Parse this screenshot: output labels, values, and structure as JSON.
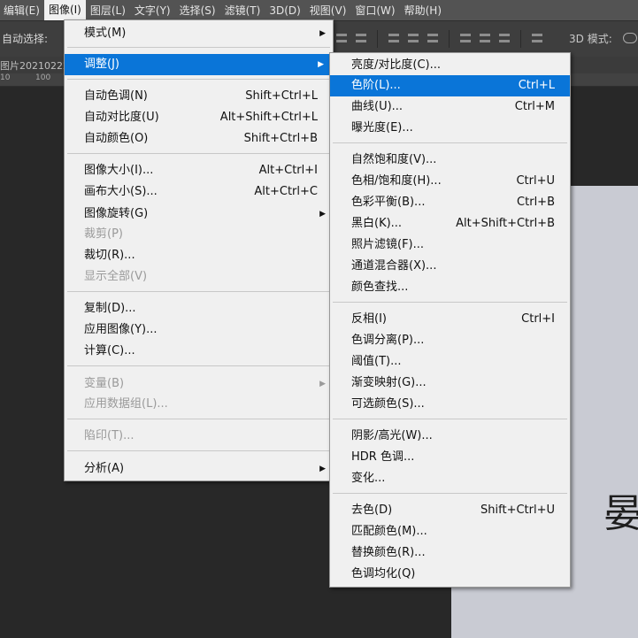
{
  "menubar": {
    "items": [
      {
        "label": "编辑(E)"
      },
      {
        "label": "图像(I)"
      },
      {
        "label": "图层(L)"
      },
      {
        "label": "文字(Y)"
      },
      {
        "label": "选择(S)"
      },
      {
        "label": "滤镜(T)"
      },
      {
        "label": "3D(D)"
      },
      {
        "label": "视图(V)"
      },
      {
        "label": "窗口(W)"
      },
      {
        "label": "帮助(H)"
      }
    ]
  },
  "options": {
    "auto_select": "自动选择:",
    "mode_3d": "3D 模式:"
  },
  "tab": {
    "name": "图片20210222"
  },
  "ruler": {
    "ticks": [
      "10",
      "100"
    ]
  },
  "image_menu": {
    "items": [
      {
        "label": "模式(M)",
        "shortcut": ""
      },
      {
        "label": "调整(J)",
        "shortcut": ""
      },
      {
        "label": "自动色调(N)",
        "shortcut": "Shift+Ctrl+L"
      },
      {
        "label": "自动对比度(U)",
        "shortcut": "Alt+Shift+Ctrl+L"
      },
      {
        "label": "自动颜色(O)",
        "shortcut": "Shift+Ctrl+B"
      },
      {
        "label": "图像大小(I)...",
        "shortcut": "Alt+Ctrl+I"
      },
      {
        "label": "画布大小(S)...",
        "shortcut": "Alt+Ctrl+C"
      },
      {
        "label": "图像旋转(G)",
        "shortcut": ""
      },
      {
        "label": "裁剪(P)",
        "shortcut": ""
      },
      {
        "label": "裁切(R)...",
        "shortcut": ""
      },
      {
        "label": "显示全部(V)",
        "shortcut": ""
      },
      {
        "label": "复制(D)...",
        "shortcut": ""
      },
      {
        "label": "应用图像(Y)...",
        "shortcut": ""
      },
      {
        "label": "计算(C)...",
        "shortcut": ""
      },
      {
        "label": "变量(B)",
        "shortcut": ""
      },
      {
        "label": "应用数据组(L)...",
        "shortcut": ""
      },
      {
        "label": "陷印(T)...",
        "shortcut": ""
      },
      {
        "label": "分析(A)",
        "shortcut": ""
      }
    ]
  },
  "adjust_menu": {
    "items": [
      {
        "label": "亮度/对比度(C)...",
        "shortcut": ""
      },
      {
        "label": "色阶(L)...",
        "shortcut": "Ctrl+L"
      },
      {
        "label": "曲线(U)...",
        "shortcut": "Ctrl+M"
      },
      {
        "label": "曝光度(E)...",
        "shortcut": ""
      },
      {
        "label": "自然饱和度(V)...",
        "shortcut": ""
      },
      {
        "label": "色相/饱和度(H)...",
        "shortcut": "Ctrl+U"
      },
      {
        "label": "色彩平衡(B)...",
        "shortcut": "Ctrl+B"
      },
      {
        "label": "黑白(K)...",
        "shortcut": "Alt+Shift+Ctrl+B"
      },
      {
        "label": "照片滤镜(F)...",
        "shortcut": ""
      },
      {
        "label": "通道混合器(X)...",
        "shortcut": ""
      },
      {
        "label": "颜色查找...",
        "shortcut": ""
      },
      {
        "label": "反相(I)",
        "shortcut": "Ctrl+I"
      },
      {
        "label": "色调分离(P)...",
        "shortcut": ""
      },
      {
        "label": "阈值(T)...",
        "shortcut": ""
      },
      {
        "label": "渐变映射(G)...",
        "shortcut": ""
      },
      {
        "label": "可选颜色(S)...",
        "shortcut": ""
      },
      {
        "label": "阴影/高光(W)...",
        "shortcut": ""
      },
      {
        "label": "HDR 色调...",
        "shortcut": ""
      },
      {
        "label": "变化...",
        "shortcut": ""
      },
      {
        "label": "去色(D)",
        "shortcut": "Shift+Ctrl+U"
      },
      {
        "label": "匹配颜色(M)...",
        "shortcut": ""
      },
      {
        "label": "替换颜色(R)...",
        "shortcut": ""
      },
      {
        "label": "色调均化(Q)",
        "shortcut": ""
      }
    ]
  },
  "document": {
    "visible_glyph": "晏"
  },
  "colors": {
    "highlight": "#0a75d8",
    "menu_bg": "#f0f0f0",
    "app_bg": "#282828"
  }
}
